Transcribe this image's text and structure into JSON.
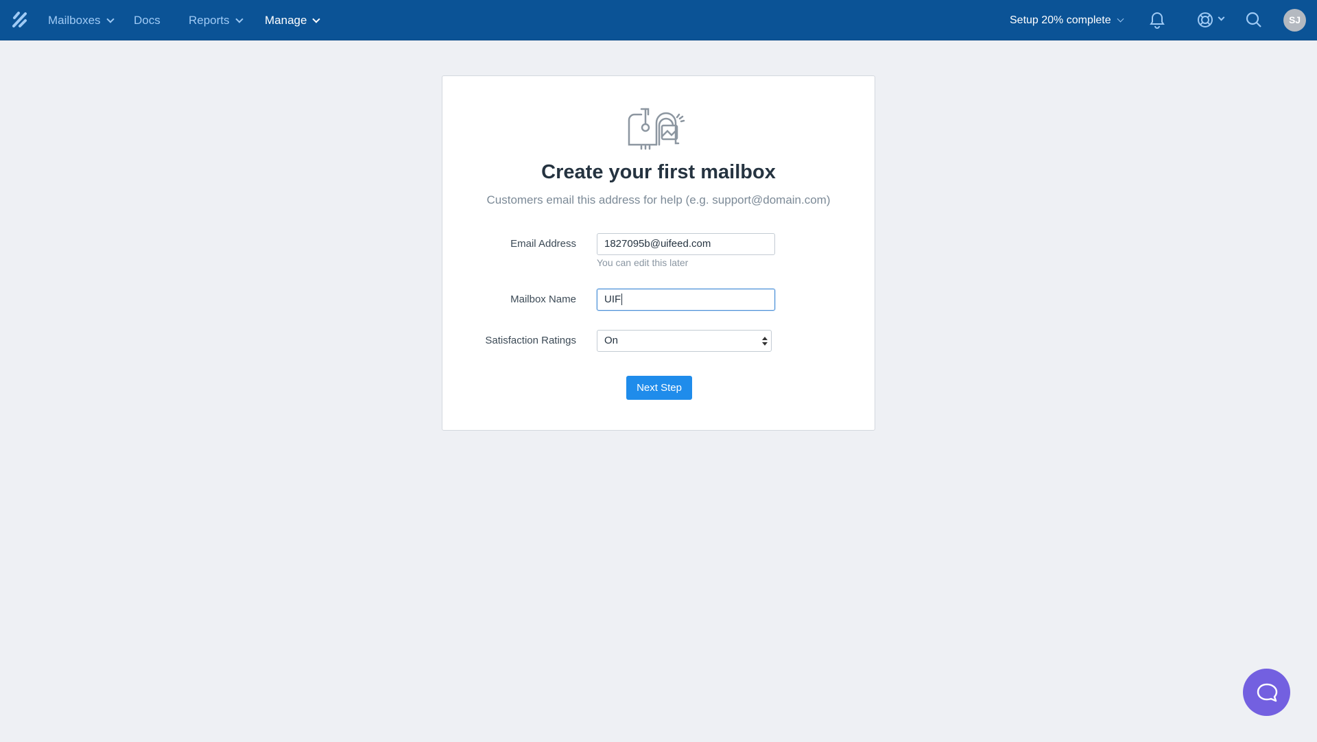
{
  "nav": {
    "items": [
      {
        "label": "Mailboxes",
        "dropdown": true
      },
      {
        "label": "Docs",
        "dropdown": false
      },
      {
        "label": "Reports",
        "dropdown": true
      },
      {
        "label": "Manage",
        "dropdown": true
      }
    ],
    "setup": "Setup 20% complete",
    "avatar": "SJ",
    "color": "#0b5396"
  },
  "card": {
    "title": "Create your first mailbox",
    "subtitle": "Customers email this address for help (e.g. support@domain.com)",
    "email_label": "Email Address",
    "email_value": "1827095b@uifeed.com",
    "email_hint": "You can edit this later",
    "name_label": "Mailbox Name",
    "name_value": "UIF",
    "ratings_label": "Satisfaction Ratings",
    "ratings_value": "On",
    "next_label": "Next Step"
  },
  "accent": "#1f8ceb",
  "chat_color": "#7360e0"
}
